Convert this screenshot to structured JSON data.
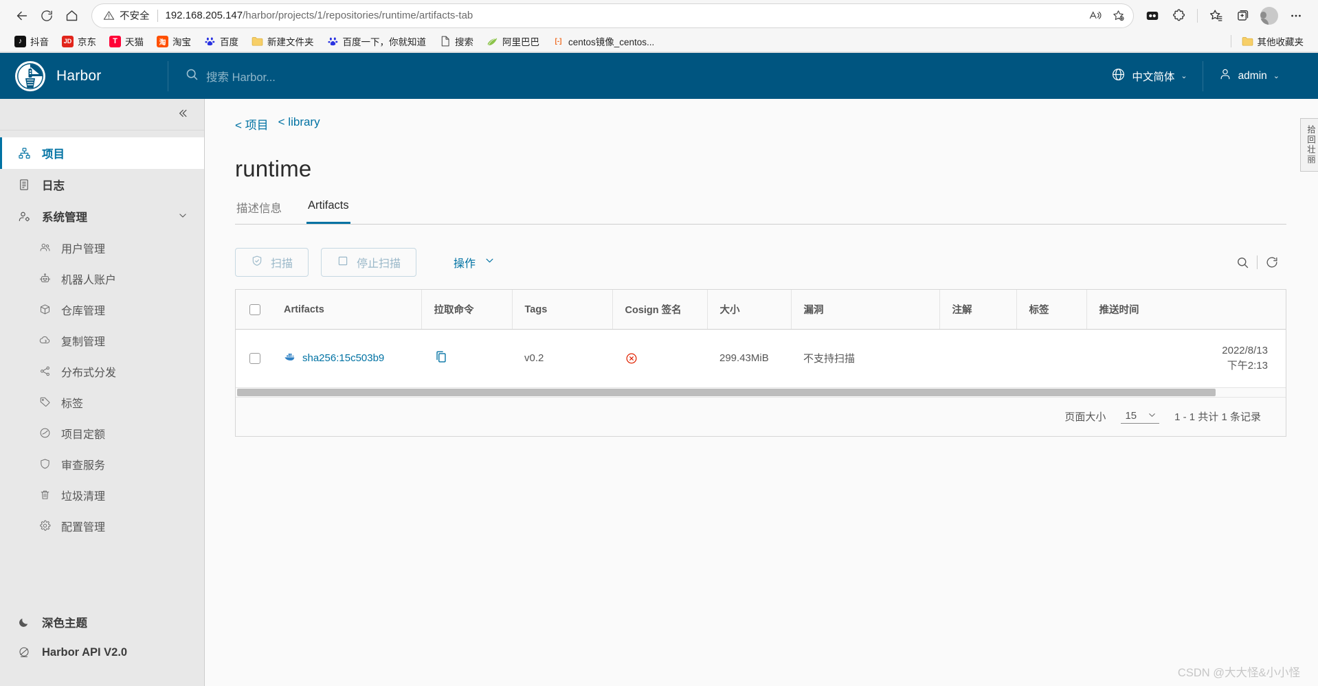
{
  "browser": {
    "back_icon": "back-arrow-icon",
    "reload_icon": "reload-icon",
    "home_icon": "home-icon",
    "security_label": "不安全",
    "url_host": "192.168.205.147",
    "url_path": "/harbor/projects/1/repositories/runtime/artifacts-tab",
    "read_aloud_icon": "read-aloud-icon",
    "favorite_icon": "add-favorite-icon",
    "split_screen_icon": "split-screen-icon",
    "extensions_icon": "extensions-icon",
    "collections_icon": "collections-icon",
    "favorites_icon": "favorites-list-icon",
    "profile_icon": "profile-avatar-icon",
    "settings_icon": "more-options-icon"
  },
  "bookmarks": {
    "items": [
      {
        "label": "抖音",
        "glyph": "♪",
        "bg": "#111111"
      },
      {
        "label": "京东",
        "glyph": "JD",
        "bg": "#e1251b"
      },
      {
        "label": "天猫",
        "glyph": "T",
        "bg": "#ff0036"
      },
      {
        "label": "淘宝",
        "glyph": "淘",
        "bg": "#ff5000"
      },
      {
        "label": "百度",
        "glyph": "熊",
        "bg": "#ffffff"
      },
      {
        "label": "新建文件夹",
        "glyph": "",
        "bg": "#f5c542"
      },
      {
        "label": "百度一下，你就知道",
        "glyph": "熊",
        "bg": "#ffffff"
      },
      {
        "label": "搜索",
        "glyph": "",
        "bg": "#ffffff"
      },
      {
        "label": "阿里巴巴",
        "glyph": "",
        "bg": "#ffffff"
      },
      {
        "label": "centos镜像_centos...",
        "glyph": "[-]",
        "bg": "#ffffff"
      }
    ],
    "other_folder_label": "其他收藏夹"
  },
  "header": {
    "brand": "Harbor",
    "logo_icon": "harbor-logo-icon",
    "search_icon": "search-icon",
    "search_placeholder": "搜索 Harbor...",
    "language_icon": "globe-icon",
    "language_label": "中文简体",
    "user_icon": "user-icon",
    "user_label": "admin",
    "caret": "⌄",
    "bg_color": "#005580"
  },
  "sidebar": {
    "collapse_icon": "double-chevron-left-icon",
    "items": [
      {
        "label": "项目",
        "icon": "projects-icon",
        "active": true
      },
      {
        "label": "日志",
        "icon": "logs-icon",
        "active": false
      },
      {
        "label": "系统管理",
        "icon": "administration-icon",
        "active": false,
        "expandable": true
      }
    ],
    "sub_items": [
      {
        "label": "用户管理",
        "icon": "users-icon"
      },
      {
        "label": "机器人账户",
        "icon": "robot-icon"
      },
      {
        "label": "仓库管理",
        "icon": "registry-icon"
      },
      {
        "label": "复制管理",
        "icon": "replication-icon"
      },
      {
        "label": "分布式分发",
        "icon": "distribution-icon"
      },
      {
        "label": "标签",
        "icon": "label-icon"
      },
      {
        "label": "项目定额",
        "icon": "quota-icon"
      },
      {
        "label": "审查服务",
        "icon": "shield-icon"
      },
      {
        "label": "垃圾清理",
        "icon": "trash-icon"
      },
      {
        "label": "配置管理",
        "icon": "gear-icon"
      }
    ],
    "bottom_items": [
      {
        "label": "深色主题",
        "icon": "moon-icon"
      },
      {
        "label": "Harbor API V2.0",
        "icon": "api-icon"
      }
    ]
  },
  "main": {
    "breadcrumb": [
      "< 项目",
      "< library"
    ],
    "page_title": "runtime",
    "tabs": [
      {
        "label": "描述信息",
        "active": false
      },
      {
        "label": "Artifacts",
        "active": true
      }
    ],
    "toolbar": {
      "scan_label": "扫描",
      "scan_icon": "scan-shield-icon",
      "stop_scan_label": "停止扫描",
      "stop_scan_icon": "stop-square-icon",
      "actions_label": "操作",
      "actions_caret": "⌄",
      "search_icon": "search-icon",
      "refresh_icon": "refresh-icon"
    },
    "table": {
      "columns": [
        "Artifacts",
        "拉取命令",
        "Tags",
        "Cosign 签名",
        "大小",
        "漏洞",
        "注解",
        "标签",
        "推送时间"
      ],
      "rows": [
        {
          "artifact": "sha256:15c503b9",
          "artifact_icon": "docker-image-icon",
          "pull_command_icon": "copy-icon",
          "tags": "v0.2",
          "cosign": "",
          "cosign_icon": "cross-circle-icon",
          "size": "299.43MiB",
          "vulnerabilities": "不支持扫描",
          "annotations": "",
          "labels": "",
          "push_time_date": "2022/8/13",
          "push_time_clock": "下午2:13"
        }
      ]
    },
    "footer": {
      "page_size_label": "页面大小",
      "page_size_value": "15",
      "page_size_caret": "⌄",
      "range_label": "1 - 1 共计 1 条记录"
    },
    "side_tab_label": "拾回壮丽",
    "watermark": "CSDN @大大怪&小小怪"
  },
  "colors": {
    "accent": "#0072a3",
    "header_bg": "#005580",
    "danger": "#e02200"
  }
}
